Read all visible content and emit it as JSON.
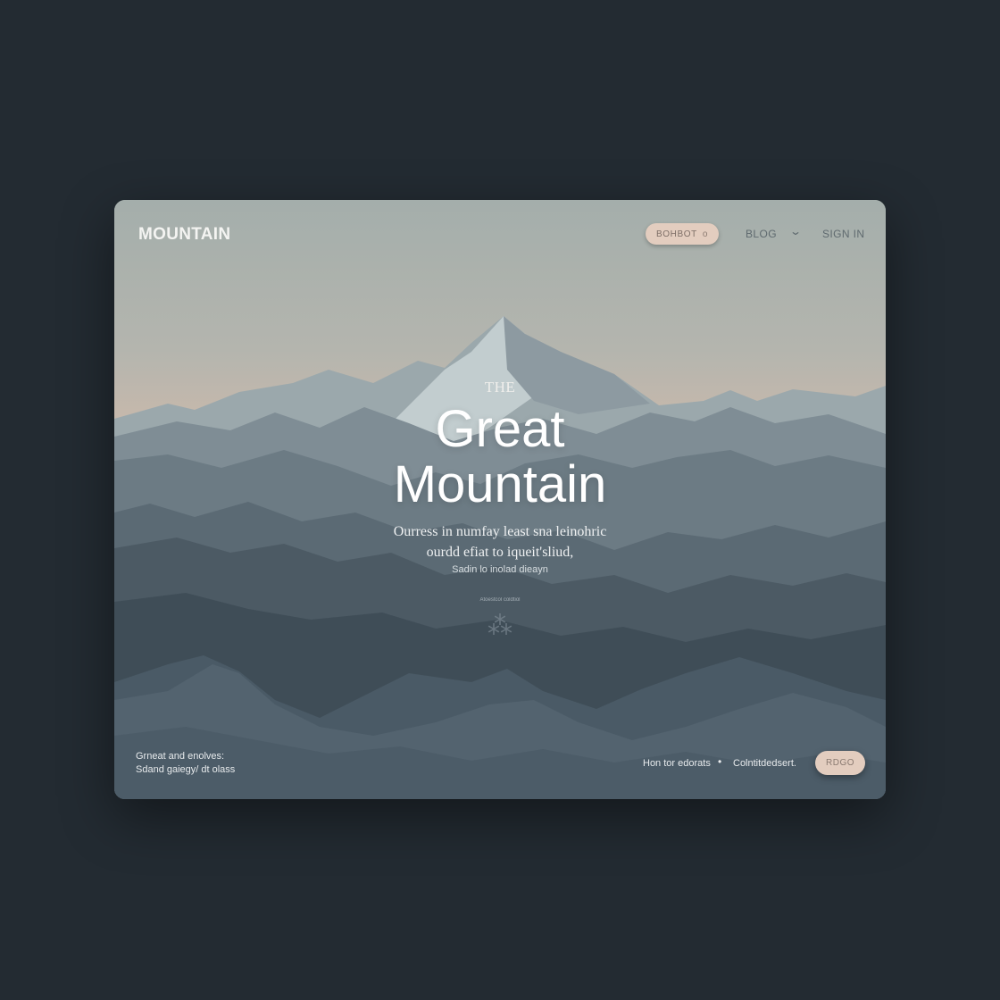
{
  "header": {
    "logo": "MOUNTAIN",
    "pill_label": "BOHBOT",
    "pill_icon": "o",
    "nav": {
      "blog": "BLOG",
      "chevron": "⌄",
      "sign_in": "SIGN IN"
    }
  },
  "hero": {
    "eyebrow": "THE",
    "title_line1": "Great",
    "title_line2": "Mountain",
    "subtitle_line1": "Ourress in numfay least sna leinohric",
    "subtitle_line2": "ourdd efiat to iqueit'sliud,",
    "small_text": "Sadin lo inolad dieayn",
    "tiny_text": "Atoestcol coldtiol",
    "glyph": "⁂"
  },
  "footer": {
    "left_line1": "Grneat and enolves:",
    "left_line2": "Sdand gaiegy/ dt olass",
    "link1": "Hon tor edorats",
    "dot": "•",
    "link2": "Colntitdedsert.",
    "cta_label": "RDGO"
  },
  "colors": {
    "page_background": "#232b32",
    "accent_pill": "#e3cdbf",
    "mountain_dark": "#3d4b56",
    "mountain_light": "#b6c2c4"
  }
}
